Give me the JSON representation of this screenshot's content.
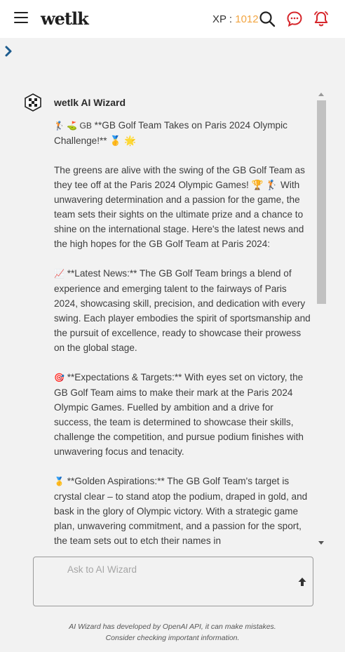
{
  "header": {
    "logo": "wetlk",
    "xp_label": "XP : ",
    "xp_value": "1012",
    "icons": [
      "menu-icon",
      "search-icon",
      "chat-icon",
      "bell-icon"
    ],
    "accent_colors": {
      "xp": "#f2a541",
      "alert": "#d6262b"
    }
  },
  "sidebar": {
    "expand_icon": "chevron-right-icon"
  },
  "chat": {
    "sender": "wetlk AI Wizard",
    "paragraphs": [
      {
        "emoji": "🏌️ ⛳ GB",
        "text": " **GB Golf Team Takes on  Paris 2024 Olympic Challenge!** 🥇 🌟"
      },
      {
        "emoji": "",
        "text": "The greens are alive with the swing of the GB Golf Team as they tee off at the  Paris 2024 Olympic Games! 🏆 🏌️ With unwavering determination and a passion for the game, the team sets their sights on the ultimate prize and a chance to shine on the international stage.  Here's the latest news and the high hopes for the GB Golf Team at Paris 2024:"
      },
      {
        "emoji": "📈",
        "text": " **Latest  News:** The GB Golf Team brings a blend of experience and emerging talent to the fairways of  Paris 2024, showcasing skill, precision, and dedication with every swing.  Each player embodies the spirit of sportsmanship and the pursuit of excellence, ready to showcase their prowess on the global stage."
      },
      {
        "emoji": "🎯",
        "text": " **Expectations & Targets:** With eyes set on victory, the GB Golf Team aims to make their mark at the  Paris 2024 Olympic Games.  Fuelled by ambition and a drive for success, the team is determined to showcase their skills, challenge the competition, and pursue podium finishes with unwavering focus and tenacity."
      },
      {
        "emoji": "🥇",
        "text": " **Golden Aspirations:** The GB Golf Team's target is crystal clear – to stand atop the podium, draped in gold, and bask in the glory of Olympic victory. With a strategic game plan, unwavering commitment, and a passion for the sport, the team sets out to etch their names in"
      }
    ]
  },
  "composer": {
    "placeholder": "Ask to AI Wizard",
    "send_icon": "arrow-up-icon"
  },
  "footer": {
    "line1": "AI Wizard has developed by OpenAI API, it can make mistakes.",
    "line2": "Consider checking important information."
  }
}
